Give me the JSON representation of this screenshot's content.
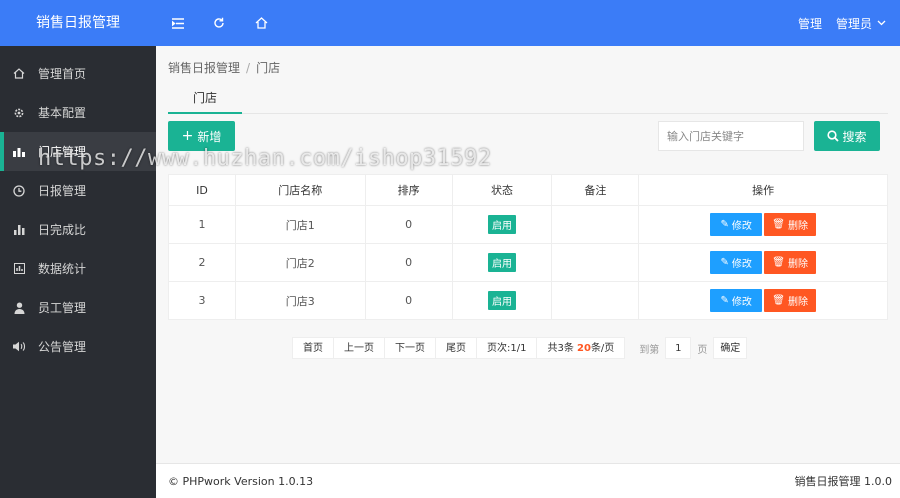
{
  "app_title": "销售日报管理",
  "header": {
    "icons": [
      "menu-fold-icon",
      "refresh-icon",
      "home-icon"
    ],
    "manage_label": "管理",
    "admin_label": "管理员"
  },
  "sidebar": {
    "items": [
      {
        "label": "管理首页",
        "icon": "home-icon"
      },
      {
        "label": "基本配置",
        "icon": "gear-icon"
      },
      {
        "label": "门店管理",
        "icon": "shop-icon",
        "active": true
      },
      {
        "label": "日报管理",
        "icon": "clock-icon"
      },
      {
        "label": "日完成比",
        "icon": "bar-chart-icon"
      },
      {
        "label": "数据统计",
        "icon": "stats-icon"
      },
      {
        "label": "员工管理",
        "icon": "user-icon"
      },
      {
        "label": "公告管理",
        "icon": "speaker-icon"
      }
    ]
  },
  "breadcrumb": {
    "root": "销售日报管理",
    "separator": "/",
    "current": "门店"
  },
  "tab": {
    "label": "门店"
  },
  "toolbar": {
    "add_label": "新增",
    "search_placeholder": "输入门店关键字",
    "search_label": "搜索"
  },
  "table": {
    "headers": [
      "ID",
      "门店名称",
      "排序",
      "状态",
      "备注",
      "操作"
    ],
    "rows": [
      {
        "id": "1",
        "name": "门店1",
        "sort": "0",
        "status": "启用",
        "note": ""
      },
      {
        "id": "2",
        "name": "门店2",
        "sort": "0",
        "status": "启用",
        "note": ""
      },
      {
        "id": "3",
        "name": "门店3",
        "sort": "0",
        "status": "启用",
        "note": ""
      }
    ],
    "edit_label": "修改",
    "delete_label": "删除"
  },
  "pagination": {
    "first": "首页",
    "prev": "上一页",
    "next": "下一页",
    "last": "尾页",
    "page_info": "页次:1/1",
    "total_prefix": "共3条 ",
    "per_page_count": "20",
    "per_page_suffix": "条/页",
    "goto_label": "到第",
    "goto_value": "1",
    "page_unit": "页",
    "confirm": "确定"
  },
  "footer": {
    "copyright": "© PHPwork Version 1.0.13",
    "version": "销售日报管理 1.0.0"
  },
  "watermark": "https://www.huzhan.com/ishop31592",
  "colors": {
    "header": "#3b7cf7",
    "sidebar": "#2a2d33",
    "accent": "#1ab394",
    "edit": "#1e9fff",
    "delete": "#ff5722"
  }
}
